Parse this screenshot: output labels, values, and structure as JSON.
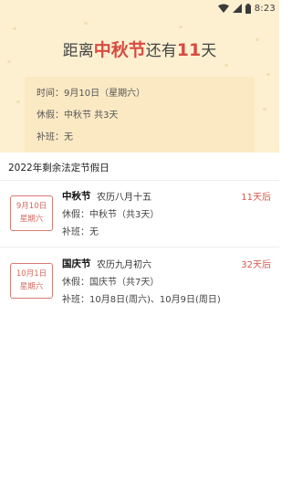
{
  "status_bar": {
    "time": "8:23"
  },
  "hero": {
    "title_prefix": "距离",
    "title_holiday": "中秋节",
    "title_mid": "还有",
    "title_days": "11",
    "title_suffix": "天",
    "time_label": "时间：",
    "time_value": "9月10日（星期六）",
    "vacation_label": "休假：",
    "vacation_value": "中秋节 共3天",
    "makeup_label": "补班：",
    "makeup_value": "无"
  },
  "section": {
    "title": "2022年剩余法定节假日"
  },
  "holidays": [
    {
      "date": "9月10日",
      "weekday": "星期六",
      "name": "中秋节",
      "lunar": "农历八月十五",
      "days_left": "11天后",
      "vacation_label": "休假：",
      "vacation_value": "中秋节（共3天）",
      "makeup_label": "补班：",
      "makeup_value": "无"
    },
    {
      "date": "10月1日",
      "weekday": "星期六",
      "name": "国庆节",
      "lunar": "农历九月初六",
      "days_left": "32天后",
      "vacation_label": "休假：",
      "vacation_value": "国庆节（共7天）",
      "makeup_label": "补班：",
      "makeup_value": "10月8日(周六)、10月9日(周日)"
    }
  ],
  "colors": {
    "accent": "#d74b41",
    "hero_bg": "#fdf0d1",
    "card_bg": "#fbe9c4"
  }
}
